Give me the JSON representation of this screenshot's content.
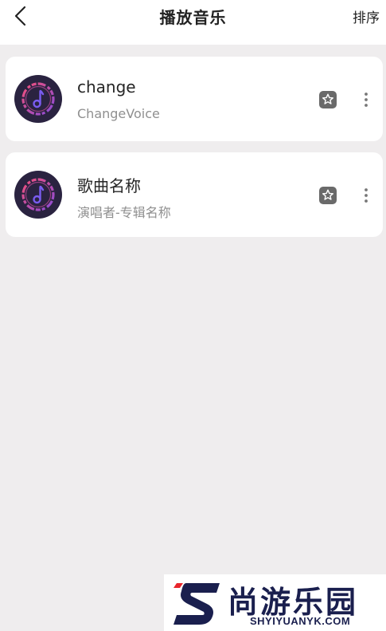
{
  "header": {
    "title": "播放音乐",
    "sort_label": "排序",
    "back_icon": "chevron-left-icon"
  },
  "songs": [
    {
      "title": "change",
      "subtitle": "ChangeVoice",
      "avatar_icon": "music-note-icon",
      "favorite_icon": "star-icon",
      "more_icon": "more-vertical-icon"
    },
    {
      "title": "歌曲名称",
      "subtitle": "演唱者-专辑名称",
      "avatar_icon": "music-note-icon",
      "favorite_icon": "star-icon",
      "more_icon": "more-vertical-icon"
    }
  ],
  "watermark": {
    "text": "尚游乐园",
    "url": "SHYIYUANYK.COM"
  },
  "colors": {
    "background": "#efedee",
    "card": "#ffffff",
    "avatar_bg": "#2a2340",
    "avatar_ring": "#e0457a",
    "note": "#7a5cf0",
    "watermark_navy": "#1a1f4e",
    "watermark_red": "#e8262c"
  }
}
